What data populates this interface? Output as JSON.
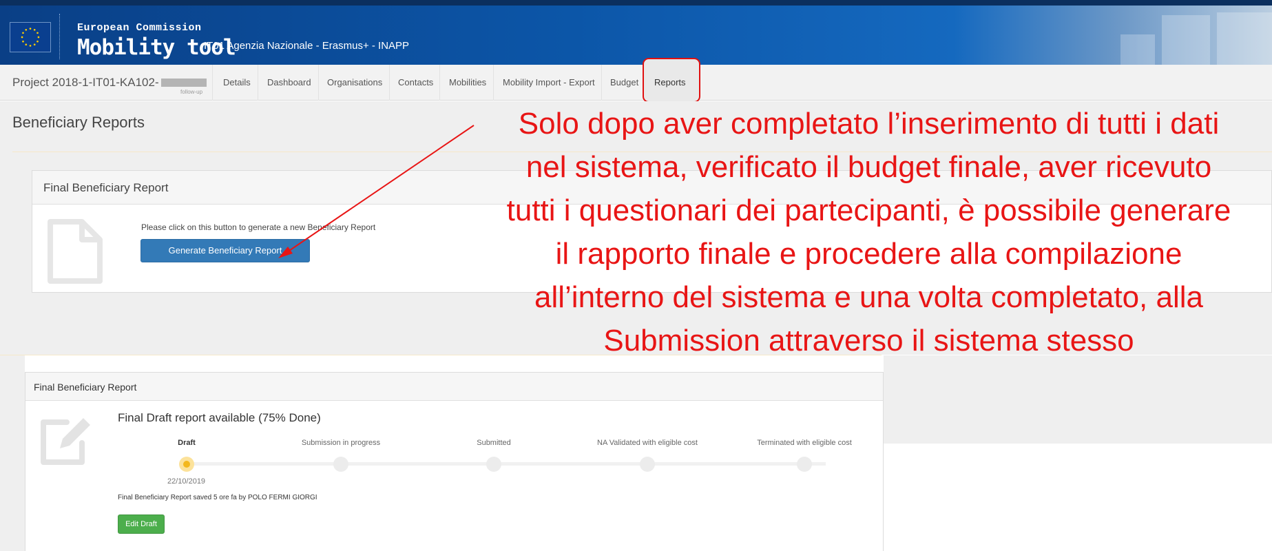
{
  "header": {
    "commission": "European Commission",
    "app_name": "Mobility tool",
    "agency": "IT01 Agenzia Nazionale - Erasmus+ - INAPP"
  },
  "nav": {
    "project": "Project 2018-1-IT01-KA102-",
    "project_suffix": "follow-up",
    "items": [
      "Details",
      "Dashboard",
      "Organisations",
      "Contacts",
      "Mobilities",
      "Mobility Import - Export",
      "Budget",
      "Reports"
    ],
    "active": "Reports"
  },
  "page": {
    "heading": "Beneficiary Reports"
  },
  "report_panel": {
    "title": "Final Beneficiary Report",
    "hint": "Please click on this button to generate a new Beneficiary Report",
    "button": "Generate Beneficiary Report"
  },
  "annotation": {
    "lines": [
      "Solo dopo aver completato l’inserimento di tutti i dati",
      "nel sistema, verificato il budget finale, aver ricevuto",
      "tutti i questionari dei partecipanti, è possibile  generare",
      "il rapporto finale e procedere alla compilazione",
      "all’interno del sistema e una volta completato, alla",
      "Submission attraverso il sistema stesso"
    ],
    "color": "#e81515"
  },
  "draft_panel": {
    "title": "Final Beneficiary Report",
    "status": "Final Draft report available (75% Done)",
    "progress_percent": 75,
    "steps": [
      "Draft",
      "Submission in progress",
      "Submitted",
      "NA Validated with eligible cost",
      "Terminated with eligible cost"
    ],
    "current_step": "Draft",
    "date": "22/10/2019",
    "saved": "Final Beneficiary Report saved 5 ore fa by POLO FERMI GIORGI",
    "edit_button": "Edit Draft"
  },
  "colors": {
    "header_blue": "#0c56a8",
    "primary_button": "#337ab7",
    "success_button": "#4cae4c",
    "annotation_red": "#e81515",
    "current_step": "#f3b81e"
  },
  "icons": [
    "eu-flag-icon",
    "document-icon",
    "edit-document-icon"
  ]
}
